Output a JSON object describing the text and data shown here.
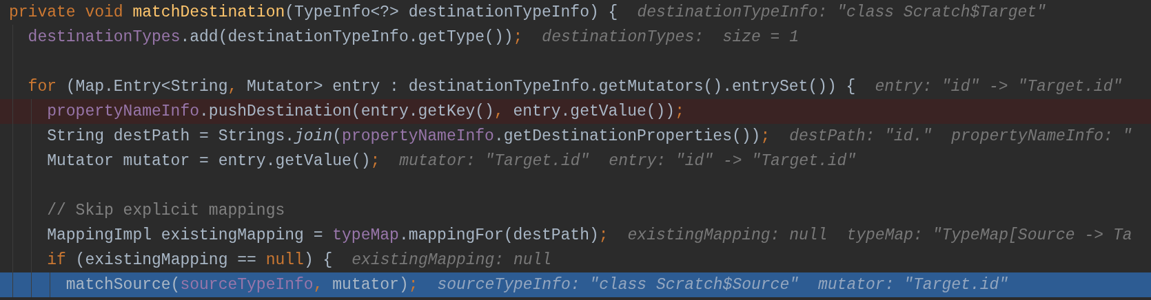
{
  "editor": {
    "lines": [
      {
        "breakpoint": false,
        "current": false,
        "code": [
          {
            "kind": "keyword",
            "text": "private void "
          },
          {
            "kind": "declaration",
            "text": "matchDestination"
          },
          {
            "kind": "plain",
            "text": "(TypeInfo<?> destinationTypeInfo) {"
          }
        ],
        "hints": [
          "destinationTypeInfo: \"class Scratch$Target\""
        ],
        "children": [
          {
            "breakpoint": false,
            "current": false,
            "code": [
              {
                "kind": "field",
                "text": "destinationTypes"
              },
              {
                "kind": "plain",
                "text": ".add(destinationTypeInfo.getType())"
              },
              {
                "kind": "keyword",
                "text": ";"
              }
            ],
            "hints": [
              "destinationTypes:  size = 1"
            ]
          },
          {
            "breakpoint": false,
            "current": false
          },
          {
            "breakpoint": false,
            "current": false,
            "code": [
              {
                "kind": "keyword",
                "text": "for "
              },
              {
                "kind": "plain",
                "text": "(Map.Entry<String"
              },
              {
                "kind": "keyword",
                "text": ", "
              },
              {
                "kind": "plain",
                "text": "Mutator> entry : destinationTypeInfo.getMutators().entrySet()) {"
              }
            ],
            "hints": [
              "entry: \"id\" -> \"Target.id\""
            ],
            "children": [
              {
                "breakpoint": true,
                "current": false,
                "code": [
                  {
                    "kind": "field",
                    "text": "propertyNameInfo"
                  },
                  {
                    "kind": "plain",
                    "text": ".pushDestination(entry.getKey()"
                  },
                  {
                    "kind": "keyword",
                    "text": ", "
                  },
                  {
                    "kind": "plain",
                    "text": "entry.getValue())"
                  },
                  {
                    "kind": "keyword",
                    "text": ";"
                  }
                ]
              },
              {
                "breakpoint": false,
                "current": false,
                "code": [
                  {
                    "kind": "plain",
                    "text": "String destPath = Strings."
                  },
                  {
                    "kind": "static",
                    "text": "join"
                  },
                  {
                    "kind": "plain",
                    "text": "("
                  },
                  {
                    "kind": "field",
                    "text": "propertyNameInfo"
                  },
                  {
                    "kind": "plain",
                    "text": ".getDestinationProperties())"
                  },
                  {
                    "kind": "keyword",
                    "text": ";"
                  }
                ],
                "hints": [
                  "destPath: \"id.\"",
                  "propertyNameInfo: \""
                ]
              },
              {
                "breakpoint": false,
                "current": false,
                "code": [
                  {
                    "kind": "plain",
                    "text": "Mutator mutator = entry.getValue()"
                  },
                  {
                    "kind": "keyword",
                    "text": ";"
                  }
                ],
                "hints": [
                  "mutator: \"Target.id\"",
                  "entry: \"id\" -> \"Target.id\""
                ]
              },
              {
                "breakpoint": false,
                "current": false
              },
              {
                "breakpoint": false,
                "current": false,
                "code": [
                  {
                    "kind": "comment",
                    "text": "// Skip explicit mappings"
                  }
                ]
              },
              {
                "breakpoint": false,
                "current": false,
                "code": [
                  {
                    "kind": "plain",
                    "text": "MappingImpl existingMapping = "
                  },
                  {
                    "kind": "field",
                    "text": "typeMap"
                  },
                  {
                    "kind": "plain",
                    "text": ".mappingFor(destPath)"
                  },
                  {
                    "kind": "keyword",
                    "text": ";"
                  }
                ],
                "hints": [
                  "existingMapping: null",
                  "typeMap: \"TypeMap[Source -> Ta"
                ]
              },
              {
                "breakpoint": false,
                "current": false,
                "code": [
                  {
                    "kind": "keyword",
                    "text": "if "
                  },
                  {
                    "kind": "plain",
                    "text": "(existingMapping == "
                  },
                  {
                    "kind": "keyword",
                    "text": "null"
                  },
                  {
                    "kind": "plain",
                    "text": ") {"
                  }
                ],
                "hints": [
                  "existingMapping: null"
                ],
                "children": [
                  {
                    "breakpoint": false,
                    "current": true,
                    "code": [
                      {
                        "kind": "plain",
                        "text": "matchSource("
                      },
                      {
                        "kind": "field",
                        "text": "sourceTypeInfo"
                      },
                      {
                        "kind": "keyword",
                        "text": ", "
                      },
                      {
                        "kind": "plain",
                        "text": "mutator)"
                      },
                      {
                        "kind": "keyword",
                        "text": ";"
                      }
                    ],
                    "hints": [
                      "sourceTypeInfo: \"class Scratch$Source\"",
                      "mutator: \"Target.id\""
                    ]
                  }
                ]
              }
            ]
          }
        ]
      }
    ]
  }
}
